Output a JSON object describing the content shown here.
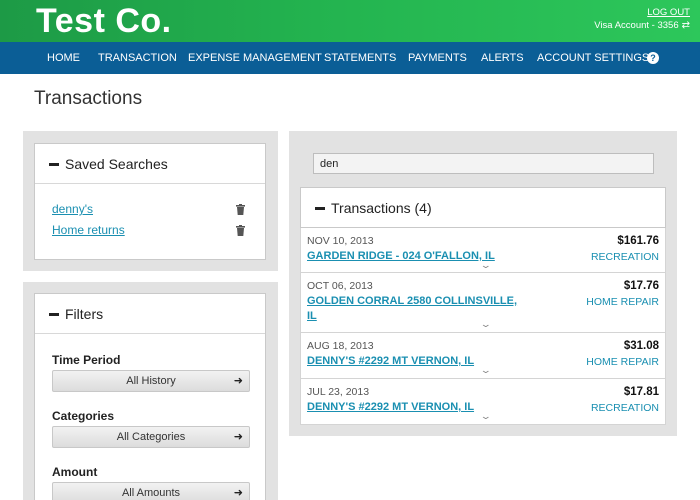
{
  "header": {
    "brand": "Test Co.",
    "logout": "LOG OUT",
    "account": "Visa Account - 3356",
    "colors": {
      "green": "#23b34f",
      "nav": "#0b5e96",
      "link": "#1a8fb1"
    }
  },
  "nav": {
    "items": [
      "HOME",
      "TRANSACTION",
      "EXPENSE MANAGEMENT",
      "STATEMENTS",
      "PAYMENTS",
      "ALERTS",
      "ACCOUNT SETTINGS"
    ],
    "help": "?"
  },
  "page": {
    "title": "Transactions"
  },
  "saved_searches": {
    "title": "Saved Searches",
    "items": [
      "denny's",
      "Home returns"
    ]
  },
  "filters": {
    "title": "Filters",
    "time_period": {
      "label": "Time Period",
      "value": "All History"
    },
    "categories": {
      "label": "Categories",
      "value": "All Categories"
    },
    "amount": {
      "label": "Amount",
      "value": "All Amounts"
    }
  },
  "search": {
    "value": "den"
  },
  "transactions": {
    "title": "Transactions (4)",
    "rows": [
      {
        "date": "NOV 10, 2013",
        "merchant": "GARDEN RIDGE - 024 O'FALLON, IL",
        "amount": "$161.76",
        "category": "RECREATION"
      },
      {
        "date": "OCT 06, 2013",
        "merchant": "GOLDEN CORRAL 2580 COLLINSVILLE, IL",
        "amount": "$17.76",
        "category": "HOME REPAIR"
      },
      {
        "date": "AUG 18, 2013",
        "merchant": "DENNY'S #2292 MT VERNON, IL",
        "amount": "$31.08",
        "category": "HOME REPAIR"
      },
      {
        "date": "JUL 23, 2013",
        "merchant": "DENNY'S #2292 MT VERNON, IL",
        "amount": "$17.81",
        "category": "RECREATION"
      }
    ]
  }
}
